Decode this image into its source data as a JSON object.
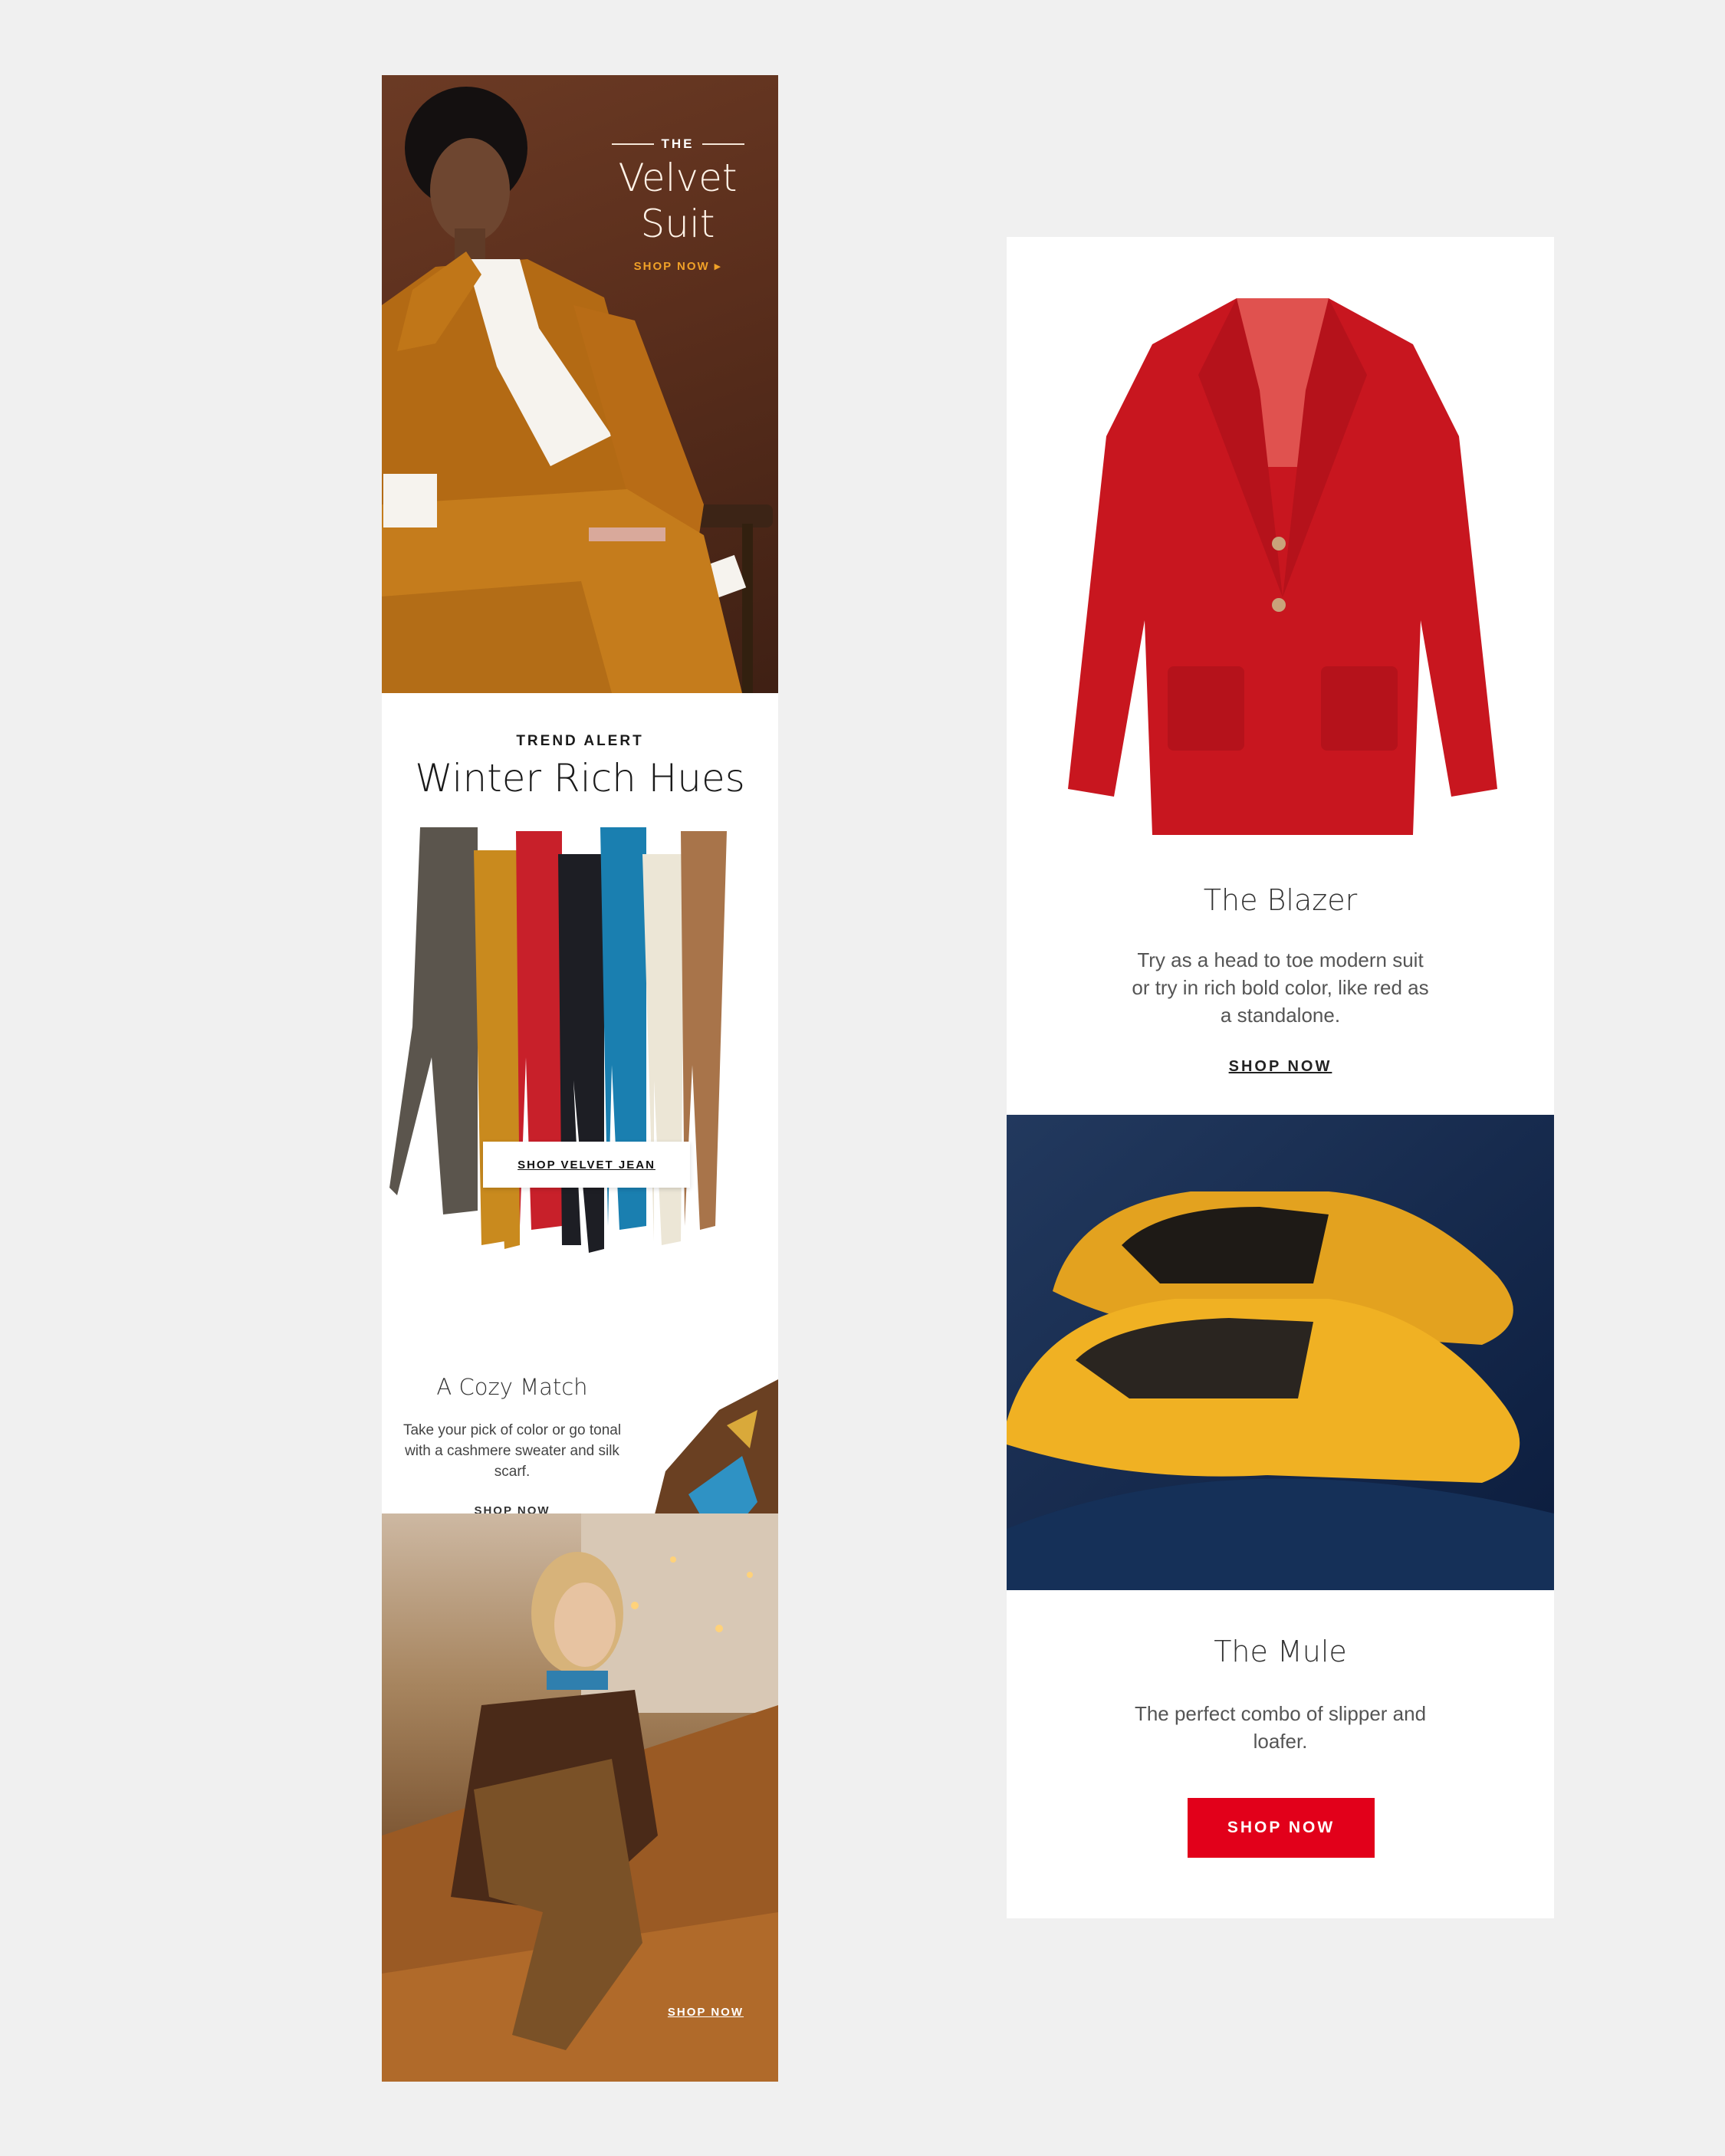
{
  "left_email": {
    "hero": {
      "kicker": "THE",
      "title": "Velvet Suit",
      "shop_label": "SHOP NOW ▸"
    },
    "trend": {
      "kicker": "TREND ALERT",
      "title": "Winter Rich Hues",
      "button_label": "SHOP VELVET JEAN"
    },
    "cozy": {
      "title": "A Cozy Match",
      "description": "Take your pick of color or go tonal with a cashmere sweater and silk scarf.",
      "shop_label": "SHOP NOW"
    },
    "lifestyle": {
      "shop_label": "SHOP NOW"
    }
  },
  "right_email": {
    "blazer": {
      "title": "The Blazer",
      "description": "Try as a head to toe modern suit or try in rich bold color, like red as a standalone.",
      "shop_label": "SHOP NOW"
    },
    "mule": {
      "title": "The Mule",
      "description": "The perfect combo of slipper and loafer.",
      "shop_label": "SHOP NOW"
    }
  },
  "colors": {
    "page_background": "#f0f0f0",
    "accent_red": "#e2001a",
    "hero_accent": "#f0a128",
    "jean_colors": [
      "#5b554d",
      "#c98a1e",
      "#c8202a",
      "#1d1e24",
      "#1a7fb0",
      "#ece6d6",
      "#a8744a"
    ]
  }
}
